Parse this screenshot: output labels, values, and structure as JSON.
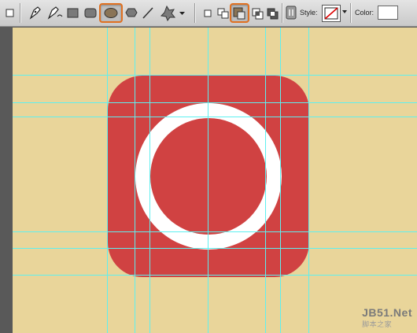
{
  "toolbar": {
    "tools": [
      "small-square-icon",
      "pen-icon",
      "freeform-pen-icon",
      "rectangle-tool-icon",
      "rounded-rectangle-tool-icon",
      "ellipse-tool-icon",
      "polygon-tool-icon",
      "line-tool-icon",
      "custom-shape-tool-icon",
      "dropdown-arrow-icon"
    ],
    "selected_tool": "ellipse-tool-icon",
    "path_ops": [
      "new-layer-icon",
      "add-to-area-icon",
      "subtract-area-icon",
      "intersect-area-icon",
      "exclude-area-icon"
    ],
    "selected_path_op": "subtract-area-icon",
    "style_label": "Style:",
    "color_label": "Color:",
    "color_value": "#ffffff"
  },
  "canvas": {
    "background": "#e9d59a",
    "icon_color": "#d04242",
    "ring_color": "#ffffff",
    "guide_color": "#5ef0f0"
  },
  "watermark": {
    "brand": "JB51",
    "dot_net": ".Net",
    "cn": "脚本之家"
  }
}
